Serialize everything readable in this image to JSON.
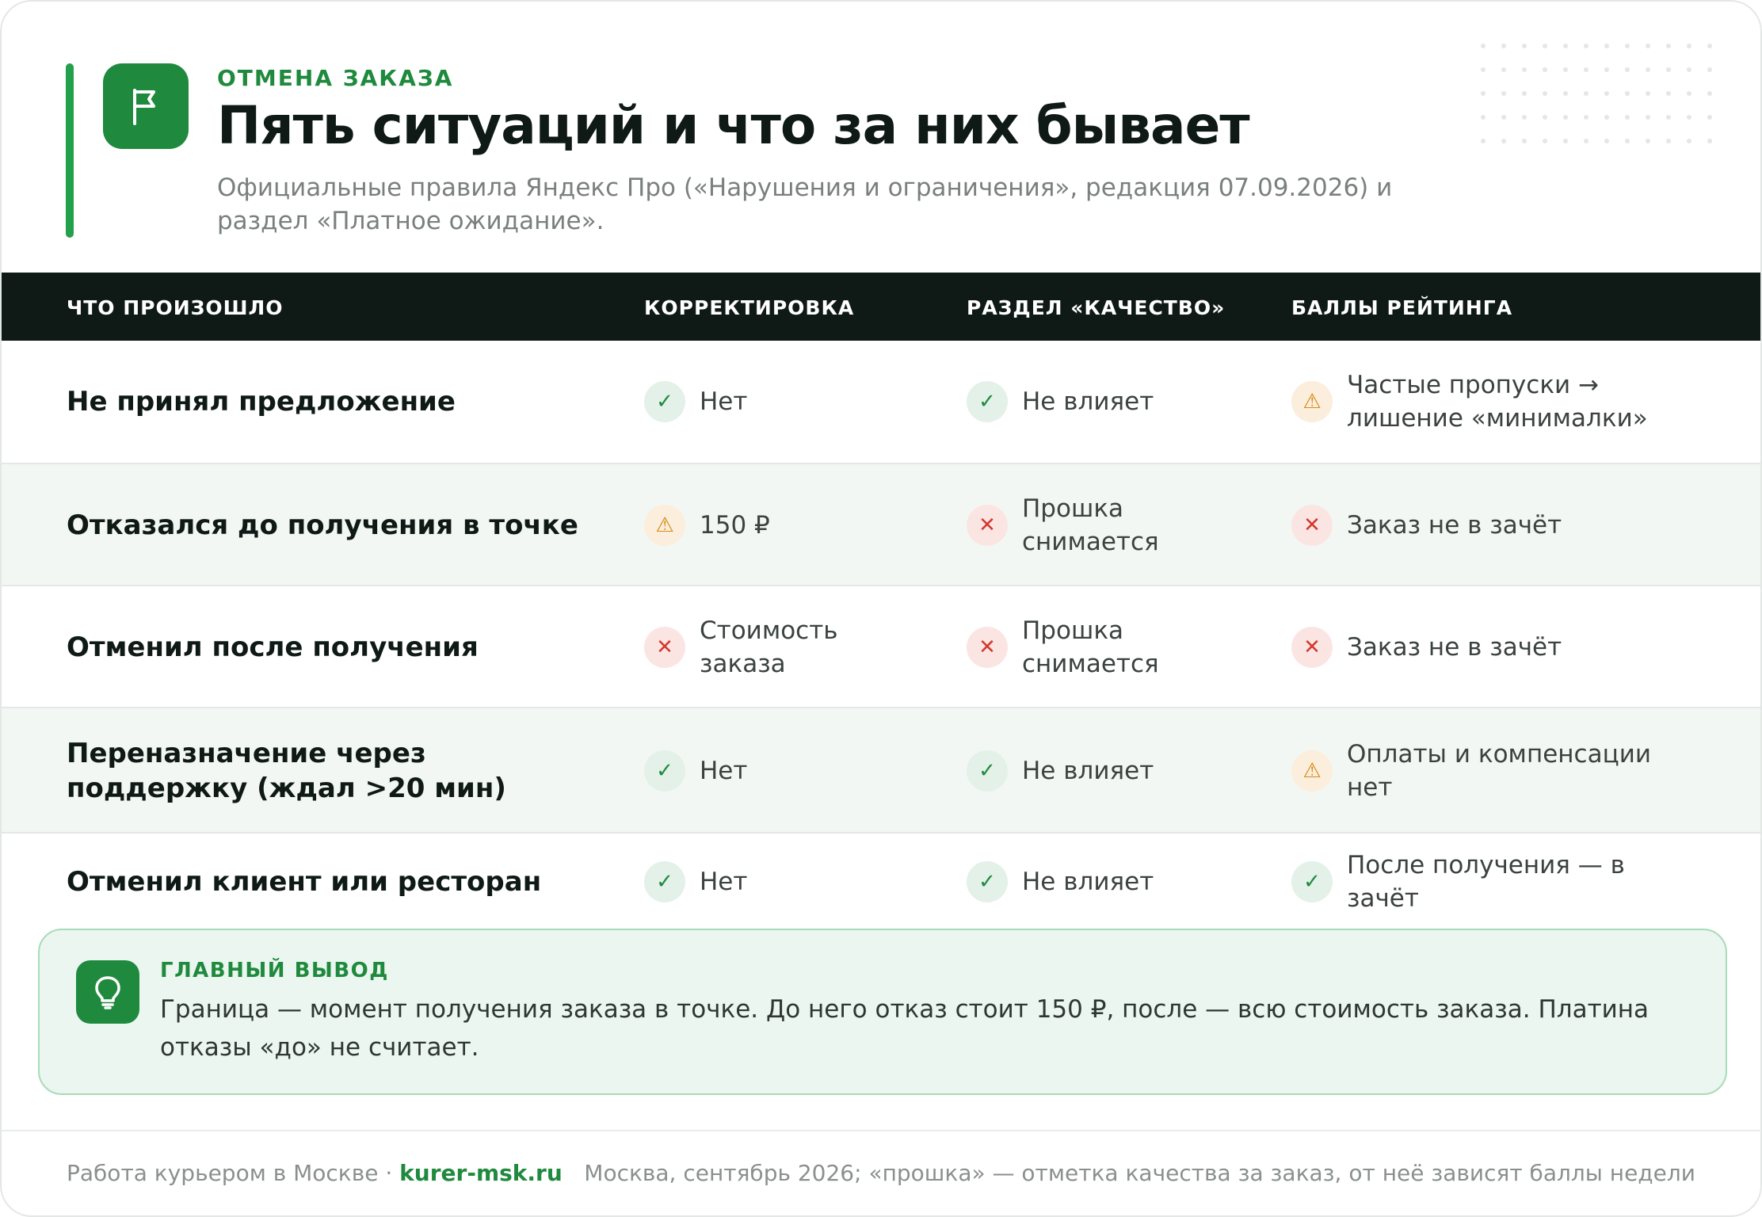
{
  "header": {
    "eyebrow": "ОТМЕНА ЗАКАЗА",
    "title": "Пять ситуаций и что за них бывает",
    "subtitle": "Официальные правила Яндекс Про («Нарушения и ограничения», редакция 07.09.2026) и раздел «Платное ожидание».",
    "icon": "flag-icon"
  },
  "table": {
    "columns": [
      "ЧТО ПРОИЗОШЛО",
      "КОРРЕКТИРОВКА",
      "РАЗДЕЛ «КАЧЕСТВО»",
      "БАЛЛЫ РЕЙТИНГА"
    ],
    "rows": [
      {
        "title": "Не принял предложение",
        "cells": [
          {
            "status": "ok",
            "text": "Нет"
          },
          {
            "status": "ok",
            "text": "Не влияет"
          },
          {
            "status": "warn",
            "text": "Частые пропуски → лишение «минималки»"
          }
        ]
      },
      {
        "title": "Отказался до получения в точке",
        "cells": [
          {
            "status": "warn",
            "text": "150 ₽"
          },
          {
            "status": "bad",
            "text": "Прошка снимается"
          },
          {
            "status": "bad",
            "text": "Заказ не в зачёт"
          }
        ]
      },
      {
        "title": "Отменил после получения",
        "cells": [
          {
            "status": "bad",
            "text": "Стоимость заказа"
          },
          {
            "status": "bad",
            "text": "Прошка снимается"
          },
          {
            "status": "bad",
            "text": "Заказ не в зачёт"
          }
        ]
      },
      {
        "title": "Переназначение через поддержку (ждал >20 мин)",
        "cells": [
          {
            "status": "ok",
            "text": "Нет"
          },
          {
            "status": "ok",
            "text": "Не влияет"
          },
          {
            "status": "warn",
            "text": "Оплаты и компенсации нет"
          }
        ]
      },
      {
        "title": "Отменил клиент или ресторан",
        "cells": [
          {
            "status": "ok",
            "text": "Нет"
          },
          {
            "status": "ok",
            "text": "Не влияет"
          },
          {
            "status": "ok",
            "text": "После получения — в зачёт"
          }
        ]
      }
    ],
    "status_icons": {
      "ok": "check-icon",
      "bad": "cross-icon",
      "warn": "warning-icon"
    }
  },
  "conclusion": {
    "label": "ГЛАВНЫЙ ВЫВОД",
    "text": "Граница — момент получения заказа в точке. До него отказ стоит 150 ₽, после — всю стоимость заказа. Платина отказы «до» не считает.",
    "icon": "lightbulb-icon"
  },
  "footer": {
    "left_text": "Работа курьером в Москве · ",
    "site": "kurer-msk.ru",
    "right_text": "Москва, сентябрь 2026; «прошка» — отметка качества за заказ, от неё зависят баллы недели"
  },
  "colors": {
    "brand_green": "#1f8a3d",
    "accent_bar": "#22a04b",
    "header_dark": "#0f1a17",
    "ok": "#1f8a3d",
    "bad": "#d2392f",
    "warn": "#d98a16"
  }
}
